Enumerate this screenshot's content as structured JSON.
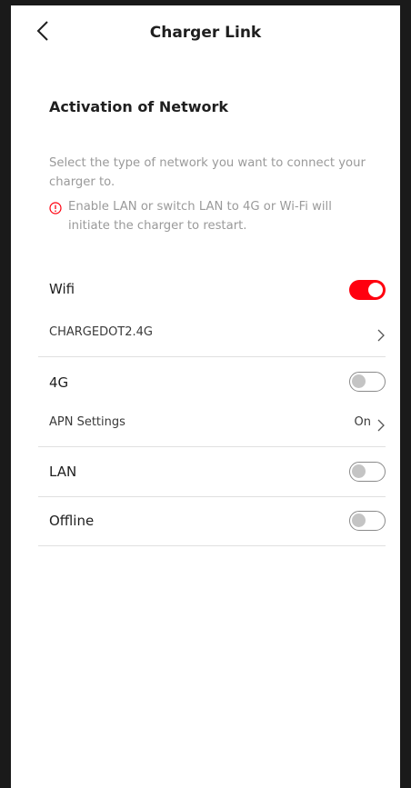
{
  "header": {
    "title": "Charger Link"
  },
  "section": {
    "title": "Activation of Network",
    "description": "Select the type of network you want to connect your charger to.",
    "warning": "Enable LAN or switch LAN to 4G or Wi-Fi will initiate the charger to restart."
  },
  "networks": {
    "wifi": {
      "label": "Wifi",
      "enabled": true,
      "ssid": "CHARGEDOT2.4G"
    },
    "cellular": {
      "label": "4G",
      "enabled": false,
      "apn_label": "APN Settings",
      "apn_value": "On"
    },
    "lan": {
      "label": "LAN",
      "enabled": false
    },
    "offline": {
      "label": "Offline",
      "enabled": false
    }
  },
  "colors": {
    "accent": "#ff000f",
    "toggle_off_border": "#8a8a8a",
    "warning_icon": "#ff000f"
  }
}
